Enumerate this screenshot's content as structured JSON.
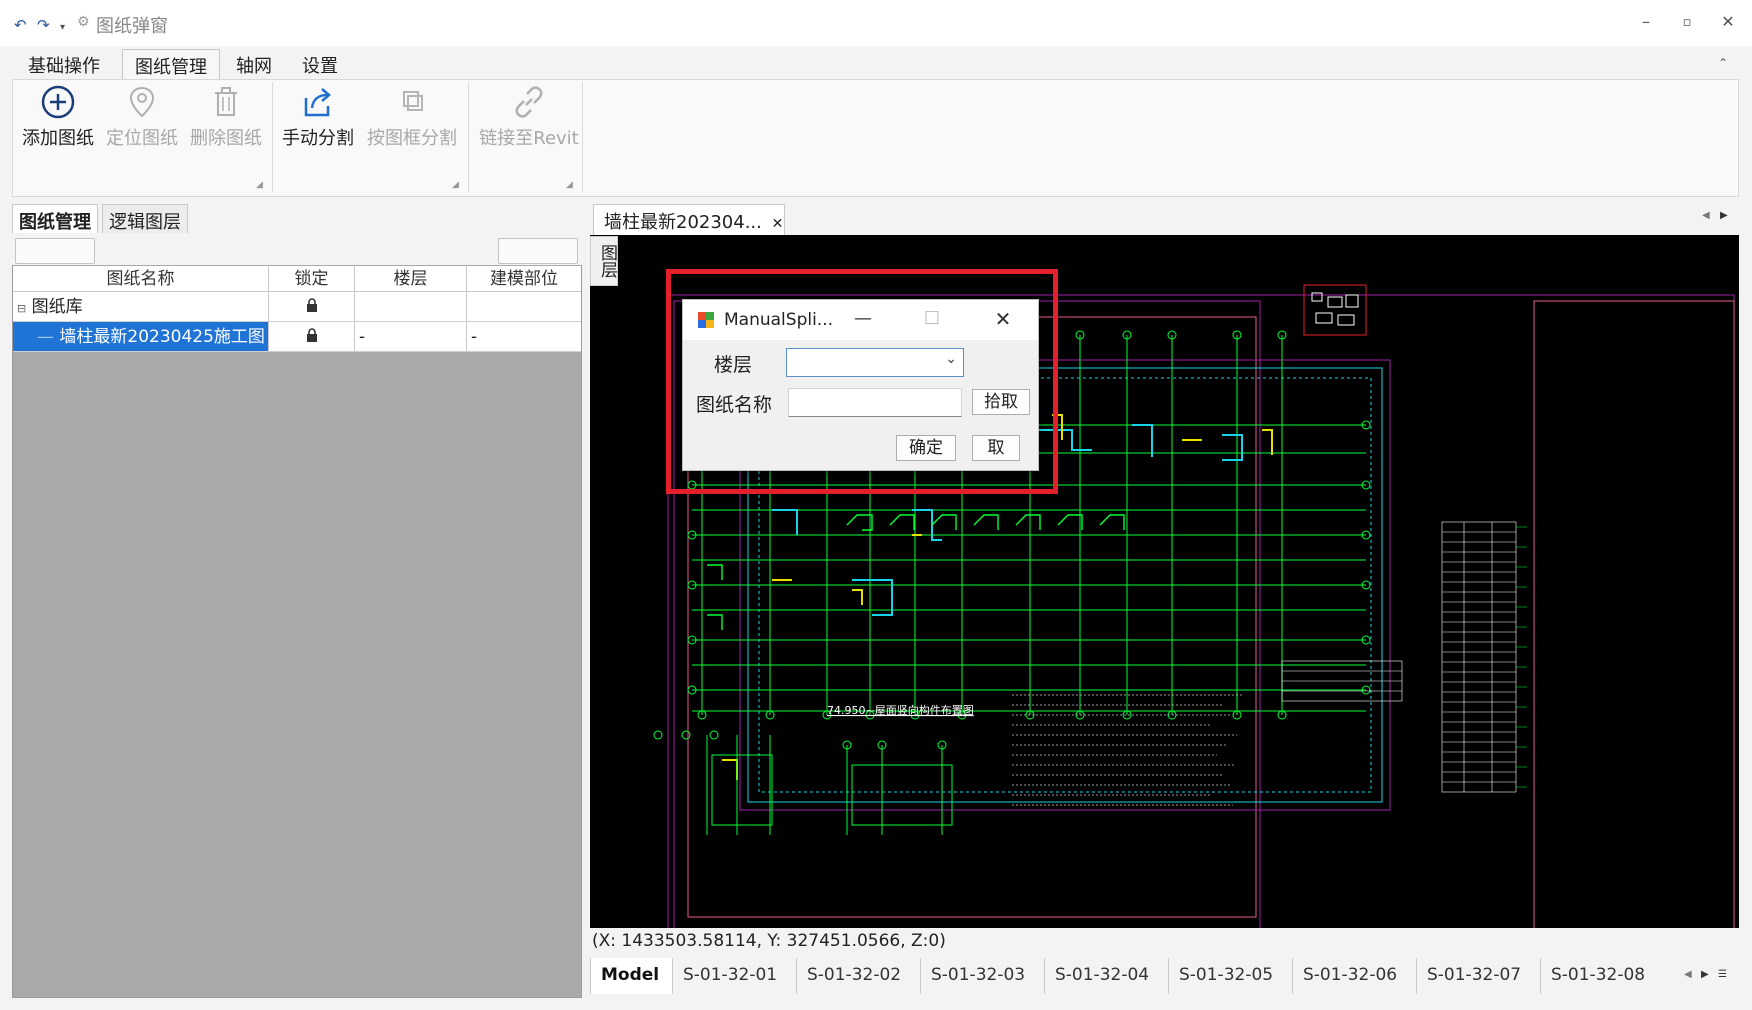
{
  "window": {
    "title": "图纸弹窗",
    "controls": [
      "minimize",
      "restore",
      "close"
    ]
  },
  "menu": {
    "tabs": [
      "基础操作",
      "图纸管理",
      "轴网",
      "设置"
    ],
    "active": 1
  },
  "ribbon": {
    "add": "添加图纸",
    "locate": "定位图纸",
    "delete": "删除图纸",
    "manual_split": "手动分割",
    "frame_split": "按图框分割",
    "link_revit": "链接至Revit"
  },
  "left_panel": {
    "tabs": [
      "图纸管理",
      "逻辑图层"
    ],
    "columns": [
      "图纸名称",
      "锁定",
      "楼层",
      "建模部位"
    ],
    "rows": [
      {
        "name": "图纸库",
        "floor": "",
        "part": ""
      },
      {
        "name": "墙柱最新20230425施工图",
        "floor": "-",
        "part": "-"
      }
    ]
  },
  "document": {
    "tab_title": "墙柱最新202304...",
    "side_button": "图层",
    "coords": "(X: 1433503.58114, Y: 327451.0566, Z:0)",
    "sheets": [
      "Model",
      "S-01-32-01",
      "S-01-32-02",
      "S-01-32-03",
      "S-01-32-04",
      "S-01-32-05",
      "S-01-32-06",
      "S-01-32-07",
      "S-01-32-08"
    ],
    "drawing_title": "74.950~屋面竖向构件布置图"
  },
  "dialog": {
    "title": "ManualSpli...",
    "floor_label": "楼层",
    "name_label": "图纸名称",
    "pick_button": "拾取",
    "ok_button": "确定",
    "cancel_button": "取"
  },
  "colors": {
    "accent": "#1f74d6",
    "highlight": "#e4202a",
    "cad_bg": "#000000",
    "cad_green": "#00ff33",
    "cad_cyan": "#19d3e6",
    "cad_yellow": "#e8e000",
    "cad_magenta": "#a020a8"
  }
}
